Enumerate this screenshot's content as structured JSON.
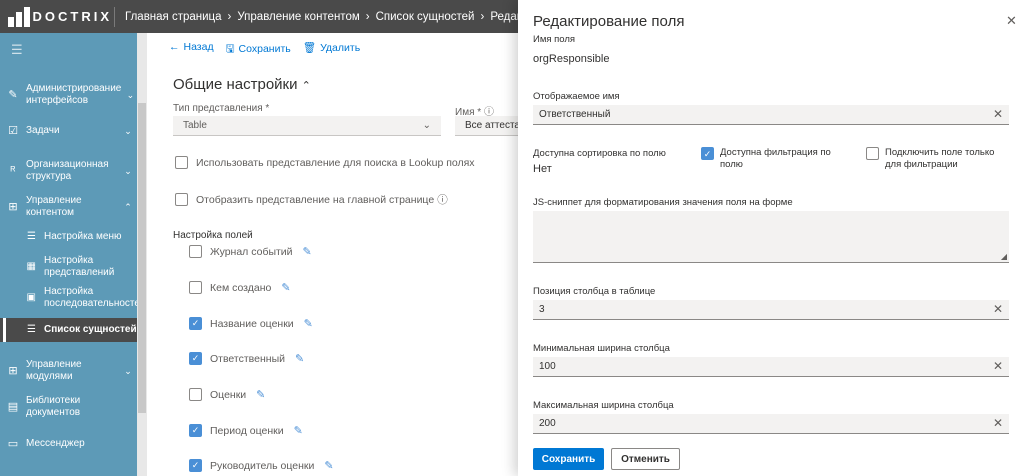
{
  "topbar": {
    "logo_text": "DOCTRIX",
    "breadcrumbs": [
      "Главная страница",
      "Управление контентом",
      "Список сущностей",
      "Редактирование табл"
    ]
  },
  "sidebar": {
    "items": [
      {
        "label": "Администрирование интерфейсов",
        "icon": "edit-icon"
      },
      {
        "label": "Задачи",
        "icon": "checkbox-icon"
      },
      {
        "label": "Организационная структура",
        "icon": "org-icon"
      },
      {
        "label": "Управление контентом",
        "icon": "content-icon"
      },
      {
        "label": "Управление модулями",
        "icon": "modules-icon"
      },
      {
        "label": "Библиотеки документов",
        "icon": "library-icon"
      },
      {
        "label": "Мессенджер",
        "icon": "chat-icon"
      }
    ],
    "subitems": [
      {
        "label": "Настройка меню"
      },
      {
        "label": "Настройка представлений"
      },
      {
        "label": "Настройка последовательностей"
      },
      {
        "label": "Список сущностей",
        "active": true
      }
    ]
  },
  "main": {
    "commands": {
      "back": "Назад",
      "save": "Сохранить",
      "delete": "Удалить"
    },
    "section_title": "Общие настройки",
    "view_type_label": "Тип представления *",
    "view_type_value": "Table",
    "name_label": "Имя *",
    "name_value": "Все аттестаци",
    "use_lookup_label": "Использовать представление для поиска в Lookup полях",
    "show_main_label": "Отобразить представление на главной странице",
    "fields_title": "Настройка полей",
    "fields": [
      {
        "label": "Журнал событий",
        "checked": false
      },
      {
        "label": "Кем создано",
        "checked": false
      },
      {
        "label": "Название оценки",
        "checked": true
      },
      {
        "label": "Ответственный",
        "checked": true
      },
      {
        "label": "Оценки",
        "checked": false
      },
      {
        "label": "Период оценки",
        "checked": true
      },
      {
        "label": "Руководитель оценки",
        "checked": true
      }
    ]
  },
  "panel": {
    "title": "Редактирование поля",
    "field_name_label": "Имя поля",
    "field_name_value": "orgResponsible",
    "display_name_label": "Отображаемое имя",
    "display_name_value": "Ответственный",
    "sorting_label": "Доступна сортировка по полю",
    "sorting_value": "Нет",
    "filter_label": "Доступна фильтрация по полю",
    "filter_checked": true,
    "filter_only_label": "Подключить поле только для фильтрации",
    "filter_only_checked": false,
    "js_label": "JS-сниппет для форматирования значения поля на форме",
    "js_value": "",
    "position_label": "Позиция столбца в таблице",
    "position_value": "3",
    "min_width_label": "Минимальная ширина столбца",
    "min_width_value": "100",
    "max_width_label": "Максимальная ширина столбца",
    "max_width_value": "200",
    "save_label": "Сохранить",
    "cancel_label": "Отменить"
  },
  "colors": {
    "accent": "#0078d4",
    "sidebar": "#5d9ab7",
    "topbar": "#4a4a4a",
    "checkbox": "#4a8fd6"
  }
}
